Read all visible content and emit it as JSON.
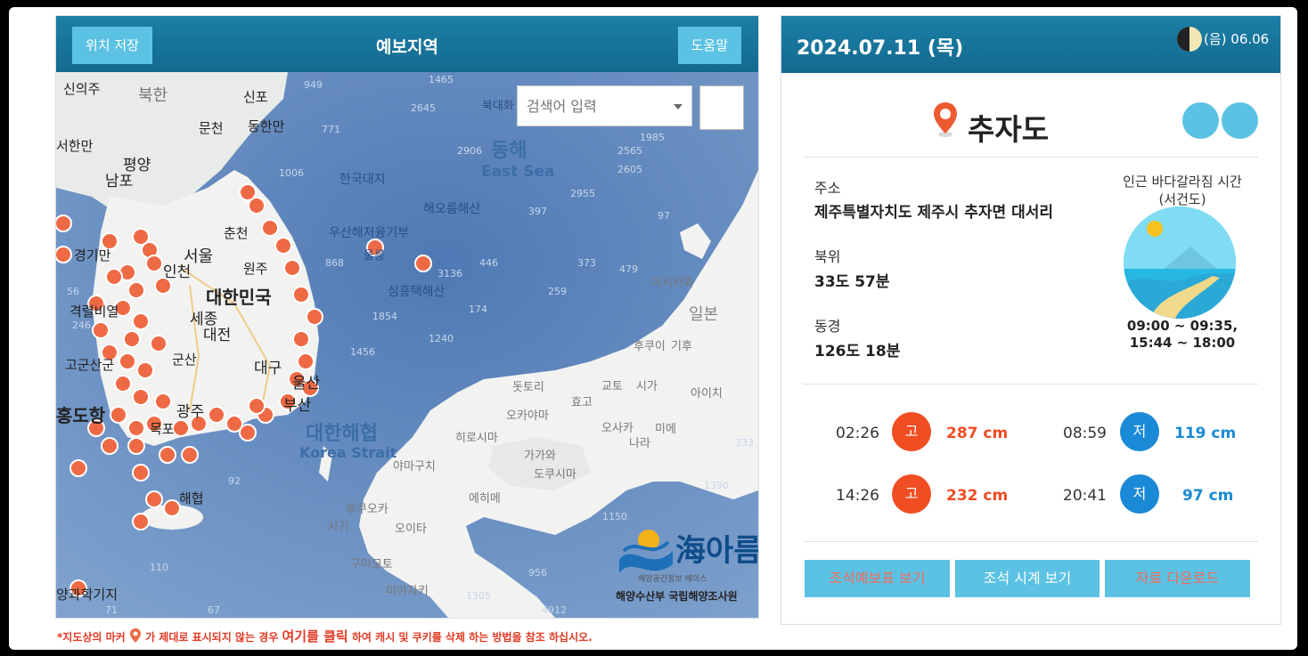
{
  "left": {
    "save_button": "위치 저장",
    "title": "예보지역",
    "help_button": "도움말",
    "search_placeholder": "검색어 입력",
    "search_icon": "",
    "map_labels": {
      "sinuiju": "신의주",
      "bukhan": "북한",
      "sinpo": "신포",
      "muncheon": "문천",
      "donghanman": "동한만",
      "seohanman": "서한만",
      "pyongyang": "평양",
      "nampo": "남포",
      "seoul": "서울",
      "incheon": "인천",
      "chuncheon": "춘천",
      "wonju": "원주",
      "korea": "대한민국",
      "gyeonggi": "경기만",
      "gyeongnyeol": "격렬비열",
      "sejong": "세종",
      "daejeon": "대전",
      "daegu": "대구",
      "gunsan": "군산",
      "gwangju": "광주",
      "ulsan": "울산",
      "busan": "부산",
      "mokpo": "목포",
      "hongdohang": "홍도항",
      "gogunsan": "고군산군",
      "donghae_ko": "동해",
      "donghae_en": "East Sea",
      "hanguk_daeji": "한국대지",
      "haeoreum": "해오름해산",
      "usanhae": "우산해저융기부",
      "ulleung": "울릉",
      "simheungtaek": "심흥택해산",
      "ilbon": "일본",
      "daehan_haehyeop": "대한해협",
      "korea_strait": "Korea Strait",
      "bukdaehwa": "북대화",
      "dottori": "돗토리",
      "okayama": "오카야마",
      "hiroshima": "히로시마",
      "yamaguchi": "야마구치",
      "gagawa": "가가와",
      "dokushima": "도쿠시마",
      "ehime": "에히메",
      "fukuoka": "후쿠오카",
      "oita": "오이타",
      "saga": "사가",
      "kumamoto": "구마모토",
      "miyazaki": "미야자키",
      "kyoto": "교토",
      "hyogo": "효고",
      "osaka": "오사카",
      "nara": "나라",
      "mie": "미에",
      "shiga": "시가",
      "aichi": "아이치",
      "ishikawa": "이시카와",
      "fukui": "후쿠이",
      "gifu": "기후",
      "gwahak": "양과학기지"
    },
    "depths": [
      "949",
      "1465",
      "2645",
      "2906",
      "2565",
      "1985",
      "1006",
      "2955",
      "2605",
      "397",
      "868",
      "446",
      "373",
      "479",
      "259",
      "1854",
      "174",
      "1240",
      "1456",
      "1390",
      "1150",
      "956",
      "1305",
      "67",
      "110",
      "56",
      "92",
      "333",
      "3136",
      "4912",
      "1905",
      "771",
      "836",
      "97",
      "246",
      "71"
    ],
    "logo": {
      "name": "海아름",
      "sub": "해양공간정보 베이스",
      "org": "해양수산부 국립해양조사원"
    },
    "note_before": "*지도상의 마커",
    "note_mid": "가 제대로 표시되지 않는 경우",
    "note_click": "여기를 클릭",
    "note_after": "하여 캐시 및 쿠키를 삭제 하는 방법을 참조 하십시오."
  },
  "right": {
    "date": "2024.07.11 (목)",
    "lunar": "(음) 06.06",
    "place": "추자도",
    "icon_a": "",
    "icon_b": "",
    "address_label": "주소",
    "address": "제주특별자치도 제주시 추자면 대서리",
    "lat_label": "북위",
    "lat": "33도 57분",
    "lon_label": "동경",
    "lon": "126도 18분",
    "parting_title_1": "인근 바다갈라짐 시간",
    "parting_title_2": "(서건도)",
    "parting_time_1": "09:00 ~ 09:35,",
    "parting_time_2": "15:44 ~ 18:00",
    "tides": [
      {
        "time": "02:26",
        "type": "고",
        "level": "287 cm"
      },
      {
        "time": "08:59",
        "type": "저",
        "level": "119 cm"
      },
      {
        "time": "14:26",
        "type": "고",
        "level": "232 cm"
      },
      {
        "time": "20:41",
        "type": "저",
        "level": "97 cm"
      }
    ],
    "buttons": {
      "table": "조석예보표 보기",
      "clock": "조석 시계 보기",
      "download": "자료 다운로드",
      "icon": ""
    }
  },
  "colors": {
    "header": "#1a7aa1",
    "accent": "#5bc2e3",
    "high": "#f04d23",
    "low": "#1b8ad6"
  }
}
